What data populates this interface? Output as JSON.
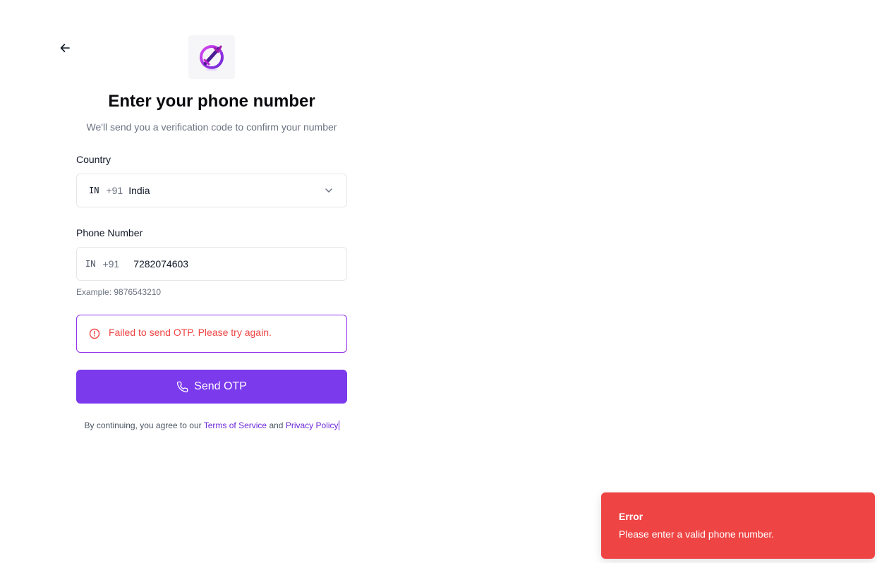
{
  "header": {
    "back_icon": "arrow-left-icon",
    "logo_icon": "logo-icon",
    "title": "Enter your phone number",
    "subtitle": "We'll send you a verification code to confirm your number"
  },
  "form": {
    "country": {
      "label": "Country",
      "flag_code": "IN",
      "dial_code": "+91",
      "name": "India",
      "icon": "chevron-down-icon"
    },
    "phone": {
      "label": "Phone Number",
      "flag_code": "IN",
      "dial_code": "+91",
      "value": "7282074603",
      "hint": "Example: 9876543210"
    },
    "error": {
      "icon": "alert-circle-icon",
      "message": "Failed to send OTP. Please try again."
    },
    "submit": {
      "icon": "phone-icon",
      "label": "Send OTP"
    }
  },
  "terms": {
    "prefix": "By continuing, you agree to our",
    "tos": "Terms of Service",
    "and": "and",
    "privacy": "Privacy Policy"
  },
  "toast": {
    "title": "Error",
    "message": "Please enter a valid phone number."
  },
  "colors": {
    "accent": "#7c3aed",
    "error": "#ef4444",
    "alert_border": "#9333ea"
  }
}
